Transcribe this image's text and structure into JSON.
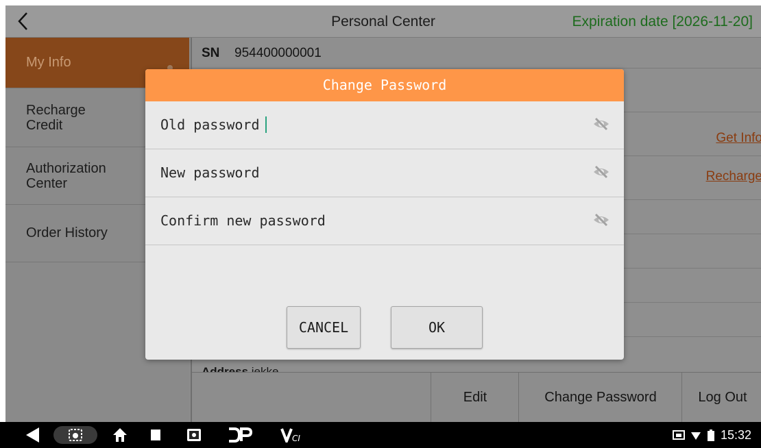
{
  "titlebar": {
    "title": "Personal Center",
    "expiration": "Expiration date [2026-11-20]"
  },
  "sidebar": {
    "items": [
      {
        "label": "My Info",
        "active": true
      },
      {
        "label": "Recharge\nCredit",
        "active": false
      },
      {
        "label": "Authorization\nCenter",
        "active": false
      },
      {
        "label": "Order History",
        "active": false
      }
    ]
  },
  "content": {
    "sn_label": "SN",
    "sn_value": "954400000001",
    "get_info_link": "Get Info",
    "recharge_link": "Recharge",
    "address_label": "Address",
    "address_value": "iekke"
  },
  "bottom_bar": {
    "edit": "Edit",
    "change_password": "Change Password",
    "log_out": "Log Out"
  },
  "dialog": {
    "title": "Change Password",
    "old_password": "Old password",
    "new_password": "New password",
    "confirm_password": "Confirm new password",
    "cancel": "CANCEL",
    "ok": "OK"
  },
  "status_bar": {
    "time": "15:32"
  },
  "colors": {
    "accent": "#fe9648",
    "expiration_text": "#1d6b1d",
    "link": "#8a3c10",
    "active_item": "#86471a"
  },
  "icons": [
    "back-arrow-icon",
    "eye-hidden-icon",
    "nav-back-icon",
    "screenshot-icon",
    "home-icon",
    "recents-icon",
    "app-icon",
    "dp-logo-icon",
    "vci-icon",
    "cast-icon",
    "wifi-icon",
    "battery-icon"
  ]
}
